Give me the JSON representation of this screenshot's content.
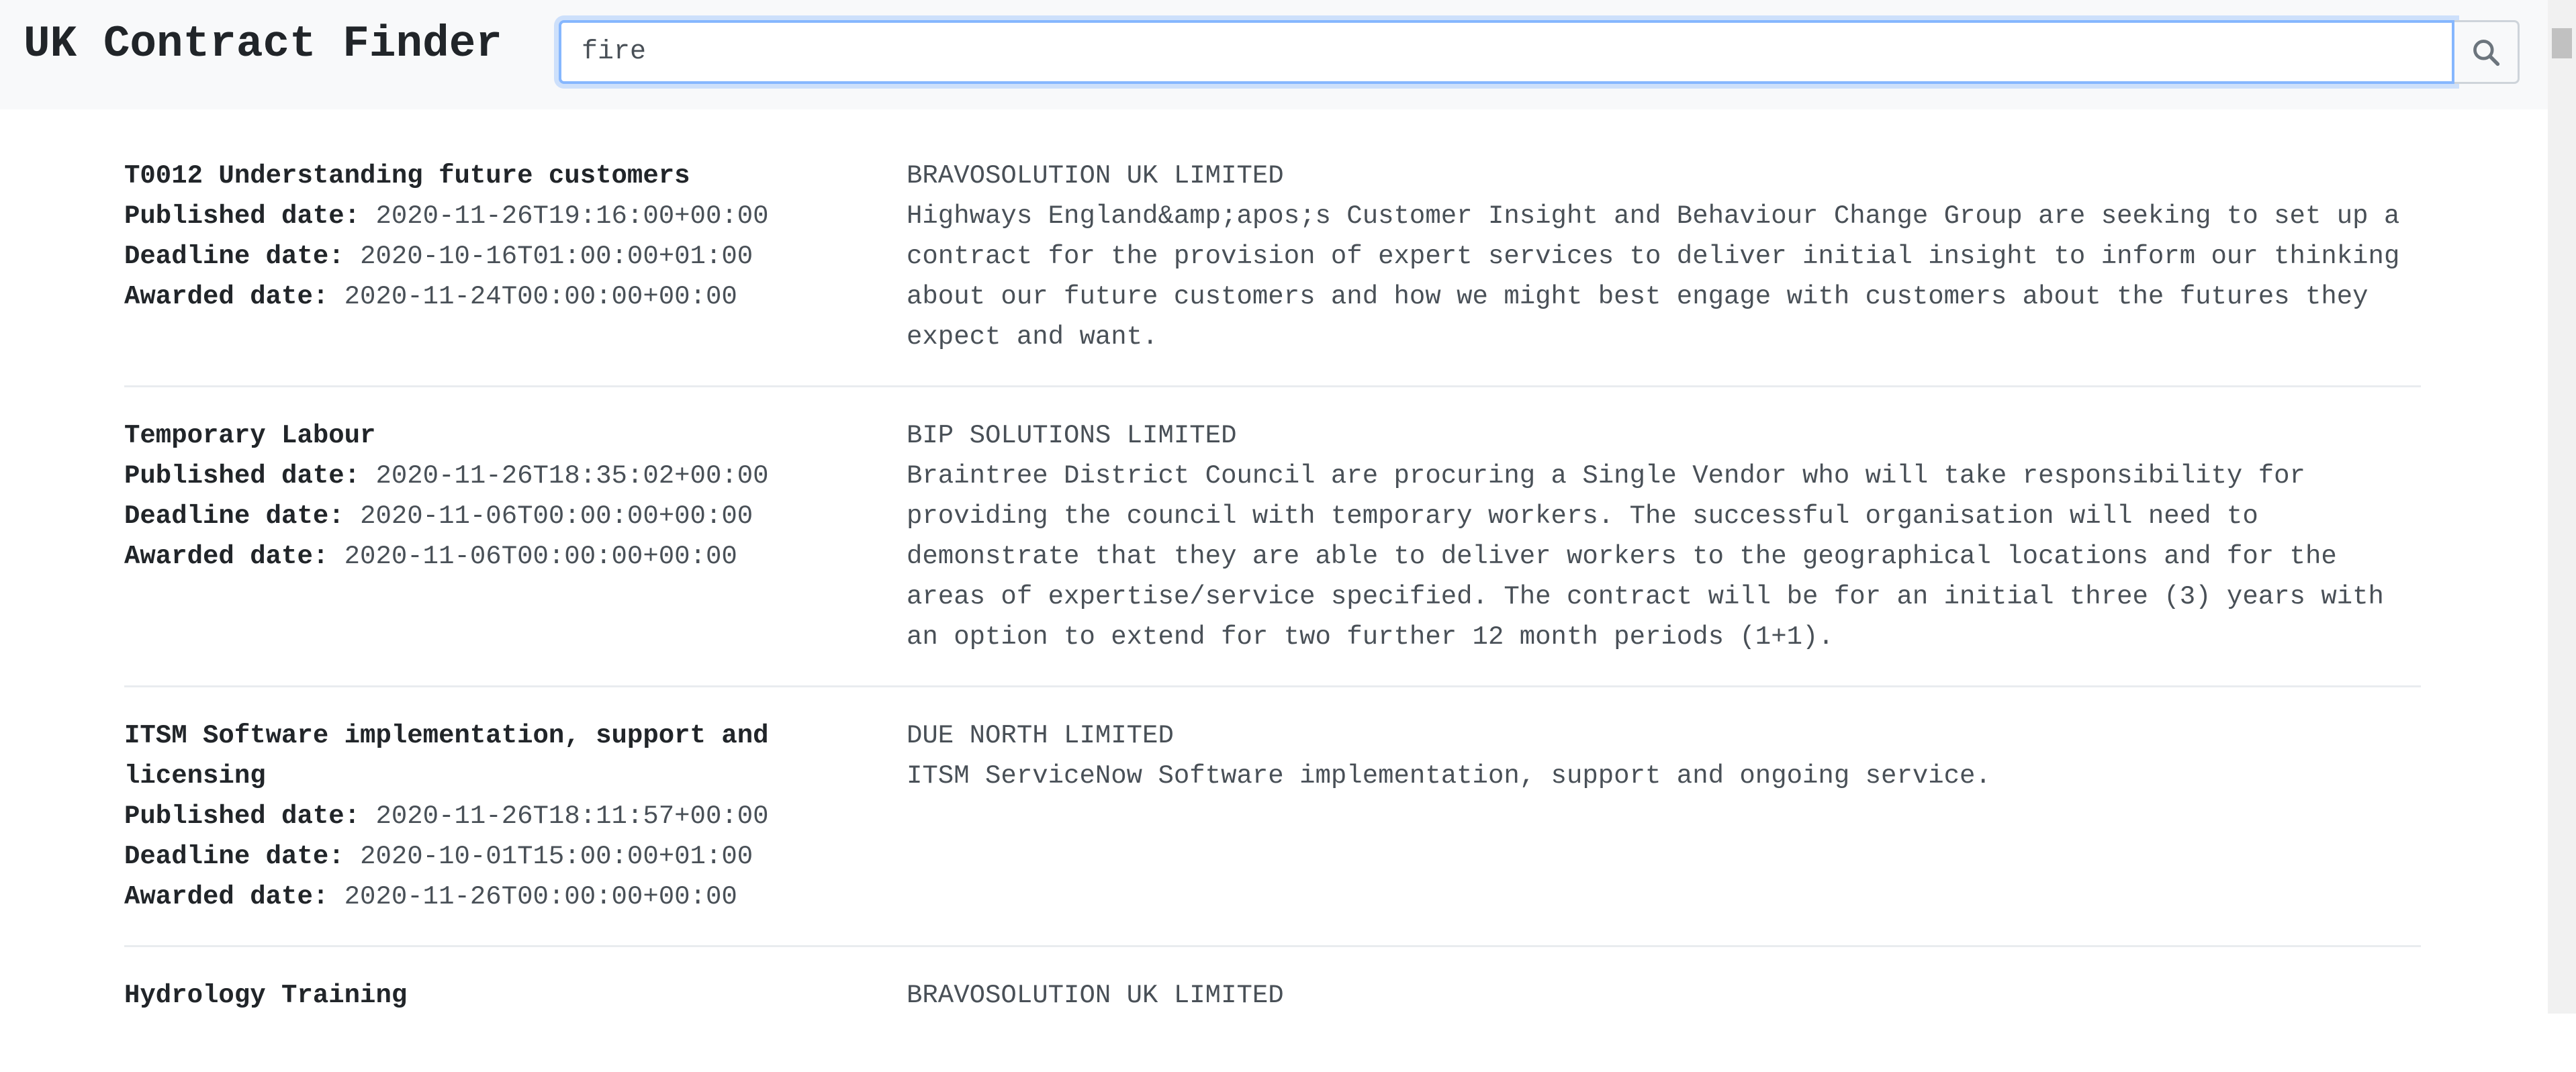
{
  "app": {
    "title": "UK Contract Finder"
  },
  "search": {
    "value": "fire",
    "icon": "search-icon"
  },
  "labels": {
    "published": "Published date:",
    "deadline": "Deadline date:",
    "awarded": "Awarded date:"
  },
  "results": [
    {
      "title": "T0012 Understanding future customers",
      "published": "2020-11-26T19:16:00+00:00",
      "deadline": "2020-10-16T01:00:00+01:00",
      "awarded": "2020-11-24T00:00:00+00:00",
      "supplier": "BRAVOSOLUTION UK LIMITED",
      "description": "Highways England&amp;apos;s Customer Insight and Behaviour Change Group are seeking to set up a contract for the provision of expert services to deliver initial insight to inform our thinking about our future customers and how we might best engage with customers about the futures they expect and want."
    },
    {
      "title": "Temporary Labour",
      "published": "2020-11-26T18:35:02+00:00",
      "deadline": "2020-11-06T00:00:00+00:00",
      "awarded": "2020-11-06T00:00:00+00:00",
      "supplier": "BIP SOLUTIONS LIMITED",
      "description": "Braintree District Council are procuring a Single Vendor who will take responsibility for providing the council with temporary workers. The successful organisation will need to demonstrate that they are able to deliver workers to the geographical locations and for the areas of expertise/service specified. The contract will be for an initial three (3) years with an option to extend for two further 12 month periods (1+1)."
    },
    {
      "title": "ITSM Software implementation, support and licensing",
      "published": "2020-11-26T18:11:57+00:00",
      "deadline": "2020-10-01T15:00:00+01:00",
      "awarded": "2020-11-26T00:00:00+00:00",
      "supplier": "DUE NORTH LIMITED",
      "description": "ITSM ServiceNow Software implementation, support and ongoing service."
    },
    {
      "title": "Hydrology Training",
      "supplier": "BRAVOSOLUTION UK LIMITED"
    }
  ]
}
